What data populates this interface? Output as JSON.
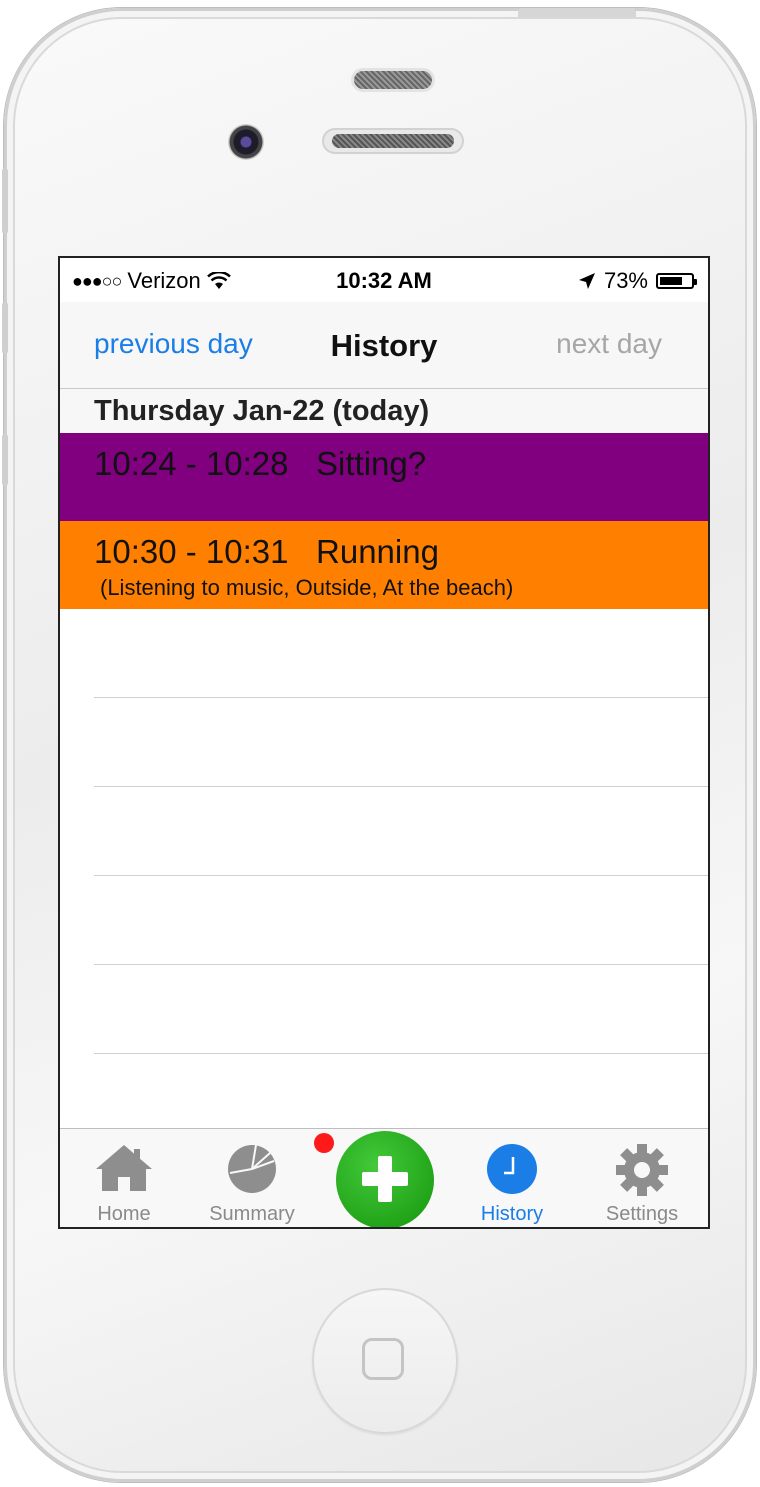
{
  "status_bar": {
    "carrier": "Verizon",
    "time": "10:32 AM",
    "battery": "73%",
    "battery_level": 0.73
  },
  "navbar": {
    "prev_label": "previous day",
    "title": "History",
    "next_label": "next day"
  },
  "section": {
    "date_label": "Thursday Jan-22 (today)"
  },
  "entries": [
    {
      "time_range": "10:24 - 10:28",
      "activity": "Sitting?",
      "details": "",
      "color": "#800080"
    },
    {
      "time_range": "10:30 - 10:31",
      "activity": "Running",
      "details": "(Listening to music, Outside, At the beach)",
      "color": "#ff8000"
    }
  ],
  "tabbar": {
    "home": "Home",
    "summary": "Summary",
    "history": "History",
    "settings": "Settings",
    "active": "history"
  },
  "colors": {
    "accent": "#1a7ee6",
    "add_button": "#2ab020",
    "badge": "#ff1a1a",
    "inactive_tab": "#8a8a8a"
  }
}
